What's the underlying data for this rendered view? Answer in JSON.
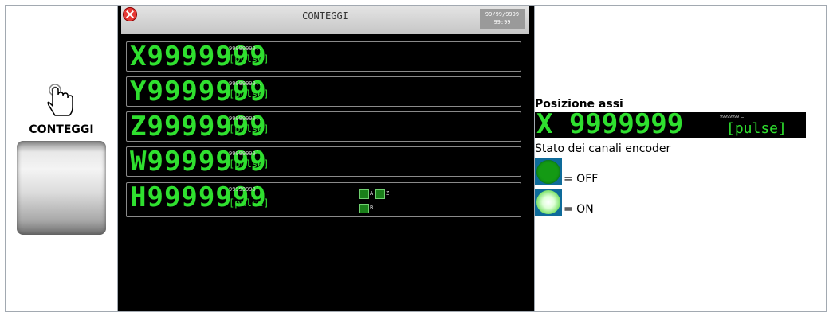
{
  "left": {
    "label": "CONTEGGI"
  },
  "screen": {
    "title": "CONTEGGI",
    "date": "99/99/9999",
    "time": "99:99",
    "rows": [
      {
        "axis": "X",
        "value": "9999999",
        "small": "99999999..",
        "unit": "[pulse]"
      },
      {
        "axis": "Y",
        "value": "9999999",
        "small": "99999999..",
        "unit": "[pulse]"
      },
      {
        "axis": "Z",
        "value": "9999999",
        "small": "99999999..",
        "unit": "[pulse]"
      },
      {
        "axis": "W",
        "value": "9999999",
        "small": "99999999ˉ",
        "unit": "[pulse]"
      },
      {
        "axis": "H",
        "value": "9999999",
        "small": "99999999ˉ",
        "unit": "[pulse]"
      }
    ],
    "encoder_labels": {
      "a": "A",
      "b": "B",
      "z": "Z"
    }
  },
  "legend": {
    "title": "Posizione assi",
    "banner_axis": "X 9999999",
    "banner_small": "99999999 …",
    "banner_unit": "[pulse]",
    "encoder_text": "Stato dei canali encoder",
    "off_label": "= OFF",
    "on_label": "= ON"
  },
  "colors": {
    "digit_green": "#2fe02f",
    "led_off": "#149a14",
    "close_red": "#e53935"
  }
}
